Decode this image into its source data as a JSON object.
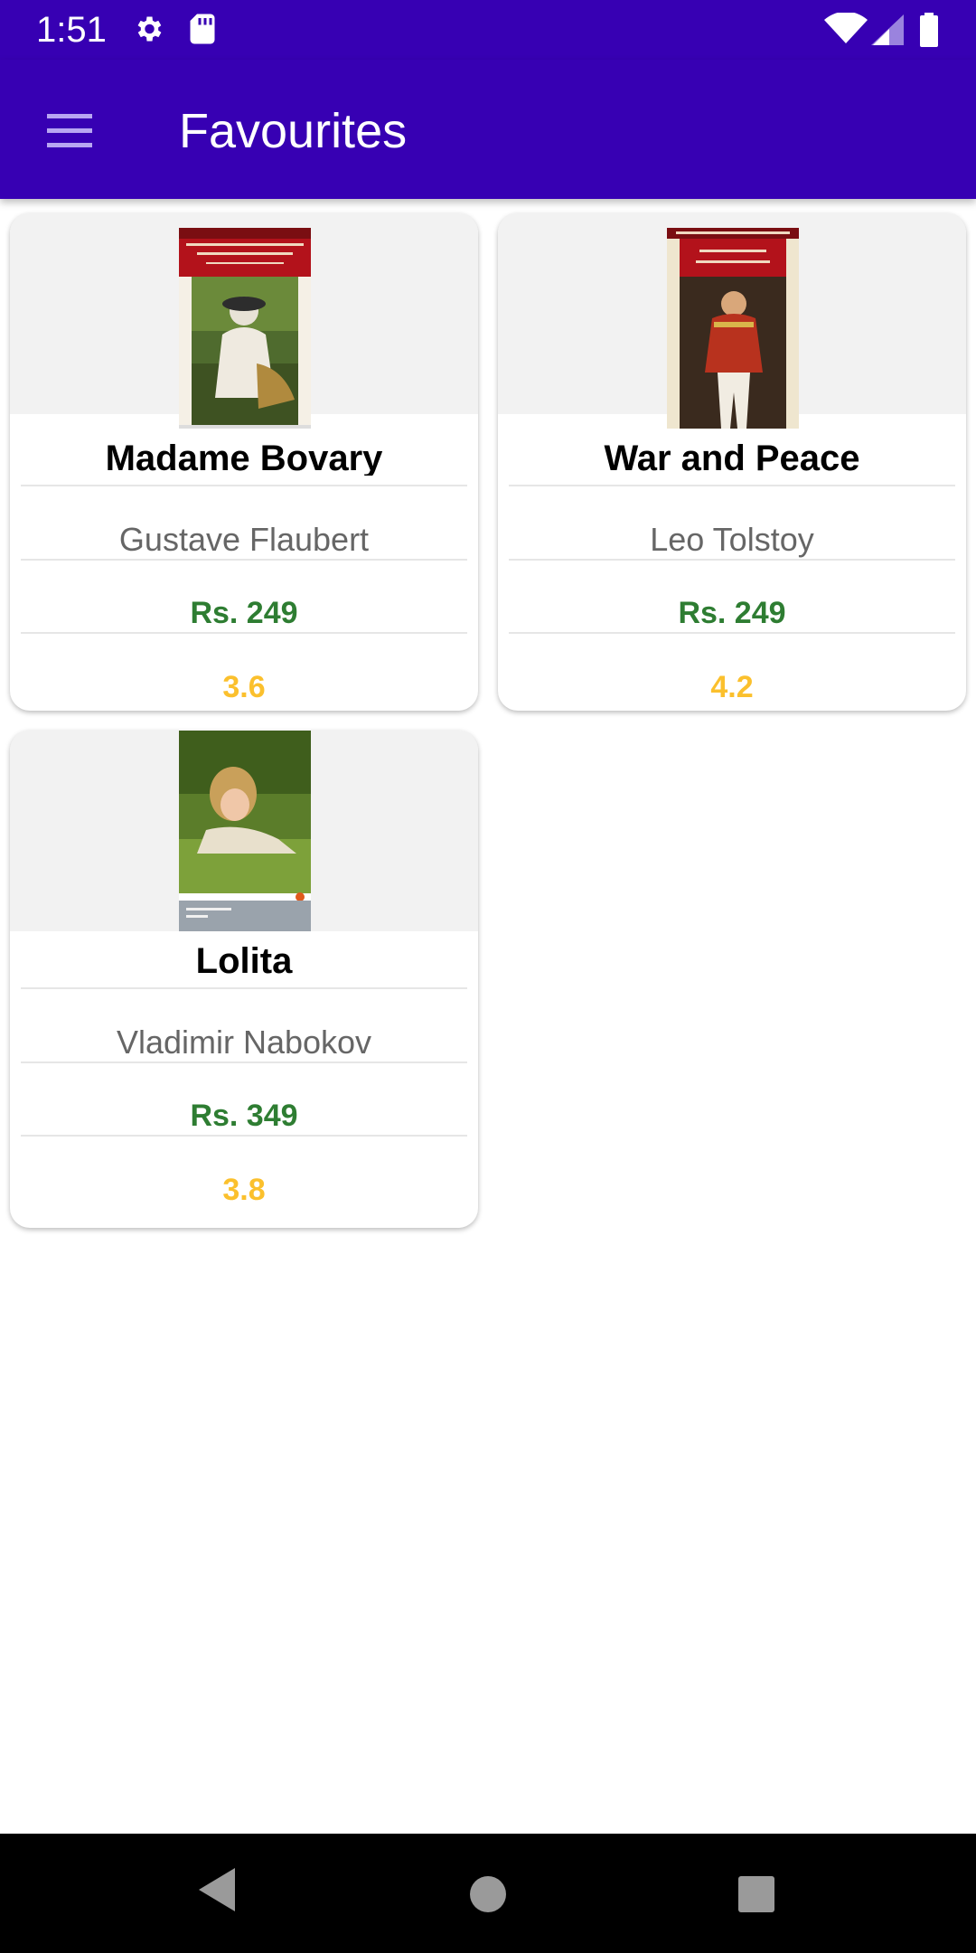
{
  "status_bar": {
    "time": "1:51",
    "icons": [
      "settings-icon",
      "sd-card-icon",
      "wifi-icon",
      "signal-icon",
      "battery-icon"
    ]
  },
  "app_bar": {
    "title": "Favourites",
    "menu_icon": "hamburger-menu-icon"
  },
  "colors": {
    "primary": "#3700b3",
    "price": "#2e7d32",
    "rating": "#fbc02d",
    "author": "#666666"
  },
  "books": [
    {
      "title": "Madame Bovary",
      "author": "Gustave Flaubert",
      "price": "Rs. 249",
      "rating": "3.6"
    },
    {
      "title": "War and Peace",
      "author": "Leo Tolstoy",
      "price": "Rs. 249",
      "rating": "4.2"
    },
    {
      "title": "Lolita",
      "author": "Vladimir Nabokov",
      "price": "Rs. 349",
      "rating": "3.8"
    }
  ],
  "nav_bar": {
    "buttons": [
      "back-icon",
      "home-icon",
      "recents-icon"
    ]
  }
}
